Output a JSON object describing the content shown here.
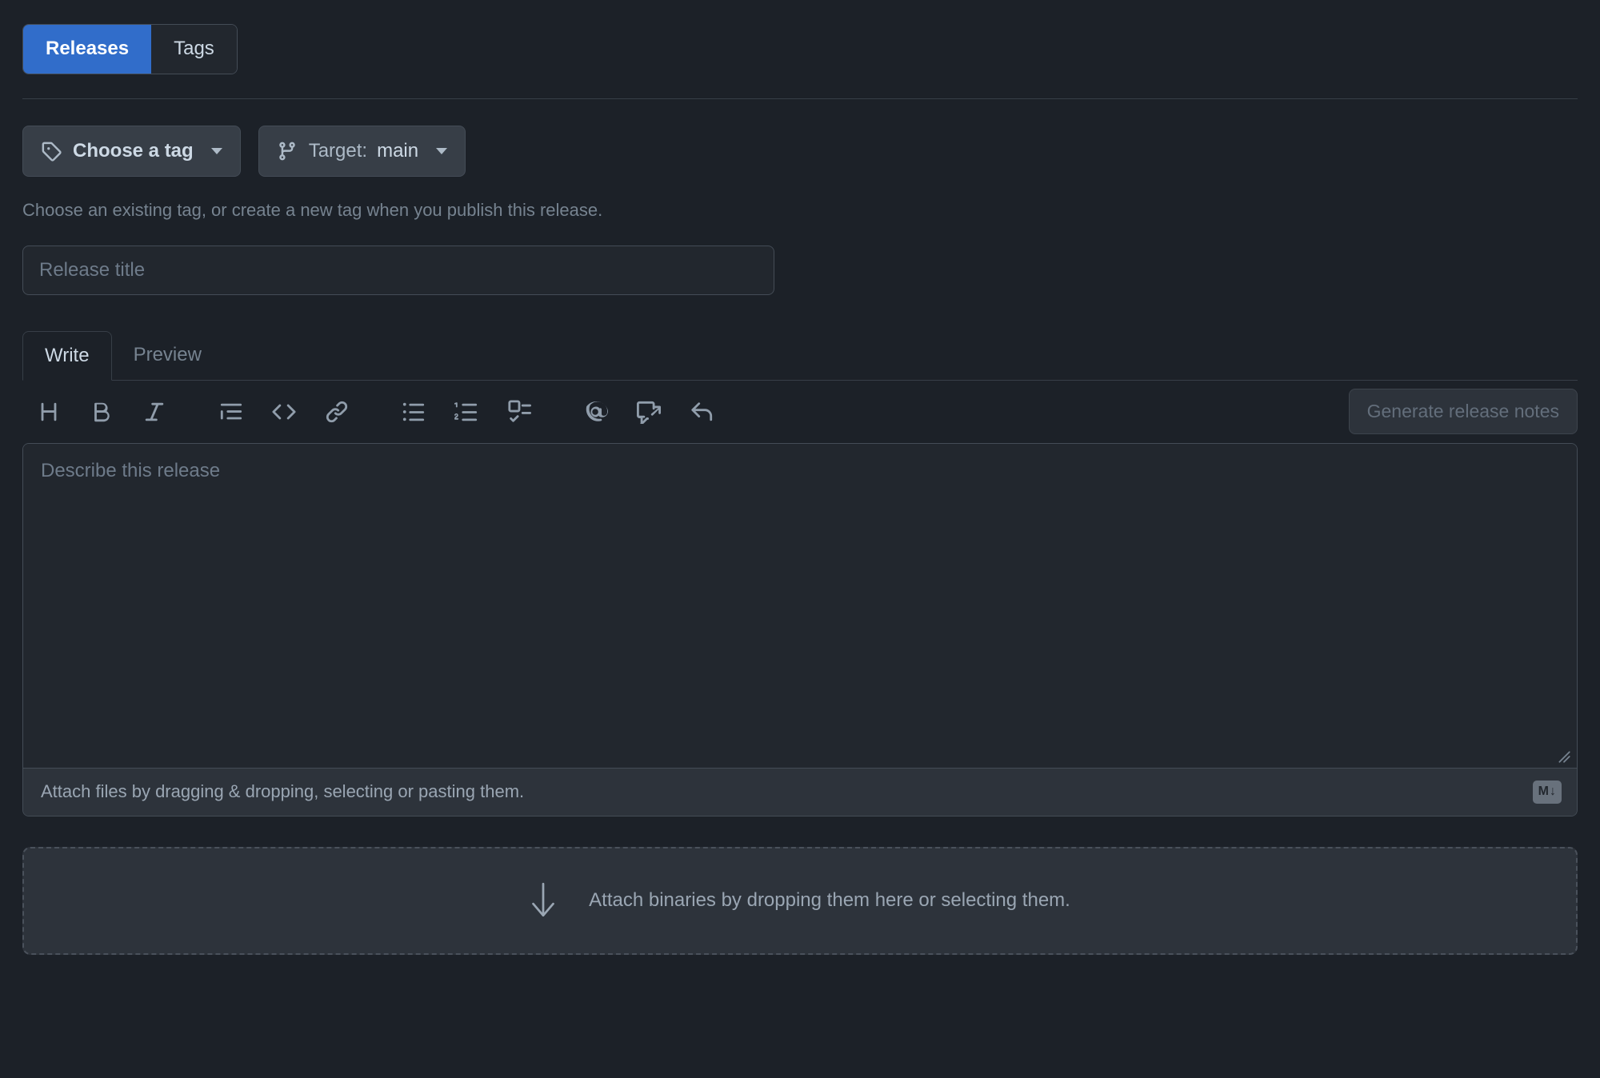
{
  "top_tabs": {
    "items": [
      {
        "label": "Releases",
        "active": true
      },
      {
        "label": "Tags",
        "active": false
      }
    ]
  },
  "tag_row": {
    "choose_tag_label": "Choose a tag",
    "choose_tag_icon": "tag-icon",
    "target_label": "Target:",
    "target_value": "main",
    "target_icon": "git-branch-icon",
    "caret_icon": "chevron-down-icon"
  },
  "helper_text": "Choose an existing tag, or create a new tag when you publish this release.",
  "release_title": {
    "value": "",
    "placeholder": "Release title"
  },
  "editor_tabs": {
    "items": [
      {
        "label": "Write",
        "active": true
      },
      {
        "label": "Preview",
        "active": false
      }
    ]
  },
  "toolbar": {
    "buttons": [
      {
        "name": "heading-icon",
        "title": "Add heading text"
      },
      {
        "name": "bold-icon",
        "title": "Add bold text"
      },
      {
        "name": "italic-icon",
        "title": "Add italic text"
      },
      {
        "name": "quote-icon",
        "title": "Add a quote"
      },
      {
        "name": "code-icon",
        "title": "Add code"
      },
      {
        "name": "link-icon",
        "title": "Add a link"
      },
      {
        "name": "unordered-list-icon",
        "title": "Add a bulleted list"
      },
      {
        "name": "ordered-list-icon",
        "title": "Add a numbered list"
      },
      {
        "name": "task-list-icon",
        "title": "Add a task list"
      },
      {
        "name": "mention-icon",
        "title": "Directly mention a user or team"
      },
      {
        "name": "cross-reference-icon",
        "title": "Reference an issue or pull request"
      },
      {
        "name": "reply-icon",
        "title": "Add saved reply"
      }
    ],
    "generate_notes_label": "Generate release notes",
    "generate_notes_disabled": true
  },
  "describe": {
    "value": "",
    "placeholder": "Describe this release"
  },
  "comment_footer": {
    "attach_text": "Attach files by dragging & dropping, selecting or pasting them.",
    "markdown_badge": "M",
    "markdown_badge_arrow": "↓"
  },
  "binaries_dropzone": {
    "icon": "arrow-down-icon",
    "text": "Attach binaries by dropping them here or selecting them."
  },
  "colors": {
    "accent": "#316dca",
    "canvas": "#1c2128",
    "inset": "#22272e",
    "button": "#373e47",
    "border": "#444c56",
    "muted_fg": "#768390"
  }
}
